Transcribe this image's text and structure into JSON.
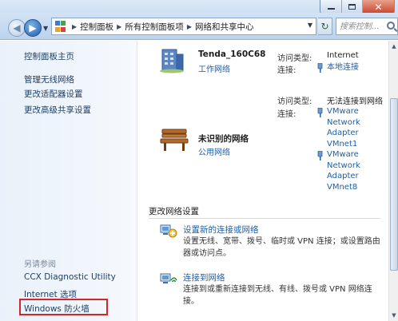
{
  "window": {
    "controls": [
      "minimize-icon",
      "maximize-icon",
      "close-icon"
    ]
  },
  "navbar": {
    "breadcrumbs": [
      "控制面板",
      "所有控制面板项",
      "网络和共享中心"
    ],
    "search_placeholder": "搜索控制..."
  },
  "sidebar": {
    "links": [
      "控制面板主页",
      "管理无线网络",
      "更改适配器设置",
      "更改高级共享设置"
    ],
    "see_also_title": "另请参阅",
    "see_also": [
      "CCX Diagnostic Utility",
      "Internet 选项",
      "Windows 防火墙"
    ]
  },
  "networks": [
    {
      "name": "Tenda_160C68",
      "type": "工作网络",
      "icon": "building-network-icon",
      "access_label": "访问类型:",
      "access_value": "Internet",
      "conn_label": "连接:",
      "connections": [
        "本地连接"
      ]
    },
    {
      "name": "未识别的网络",
      "type": "公用网络",
      "icon": "park-bench-icon",
      "access_label": "访问类型:",
      "access_value": "无法连接到网络",
      "conn_label": "连接:",
      "connections": [
        [
          "VMware",
          "Network",
          "Adapter",
          "VMnet1"
        ],
        [
          "VMware",
          "Network",
          "Adapter",
          "VMnet8"
        ]
      ]
    }
  ],
  "settings": {
    "title": "更改网络设置",
    "tasks": [
      {
        "label": "设置新的连接或网络",
        "description": "设置无线、宽带、拨号、临时或 VPN 连接；或设置路由器或访问点。",
        "icon": "new-connection-icon"
      },
      {
        "label": "连接到网络",
        "description": "连接到或重新连接到无线、有线、拨号或 VPN 网络连接。",
        "icon": "connect-network-icon"
      }
    ]
  },
  "colors": {
    "link": "#1e5fa8",
    "highlight_box": "#d2262b"
  }
}
